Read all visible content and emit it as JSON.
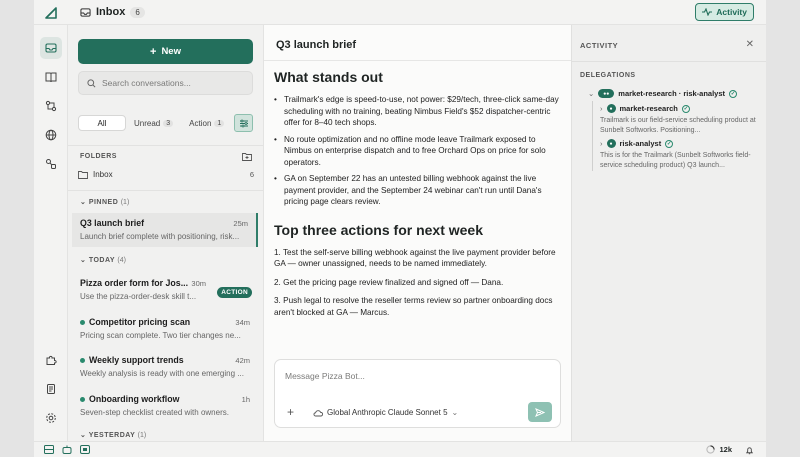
{
  "header": {
    "title": "Inbox",
    "count": "6",
    "activity_label": "Activity"
  },
  "rail": {
    "items": [
      "inbox-icon",
      "book-icon",
      "workflow-icon",
      "globe-icon",
      "connections-icon",
      "puzzle-icon",
      "scroll-icon",
      "gear-icon"
    ]
  },
  "sidebar": {
    "new_label": "New",
    "search_placeholder": "Search conversations...",
    "filters": [
      {
        "label": "All"
      },
      {
        "label": "Unread",
        "count": "3"
      },
      {
        "label": "Action",
        "count": "1"
      }
    ],
    "folders_label": "FOLDERS",
    "folder": {
      "name": "Inbox",
      "count": "6"
    },
    "pinned_label": "PINNED",
    "pinned_count": "(1)",
    "today_label": "TODAY",
    "today_count": "(4)",
    "yesterday_label": "YESTERDAY",
    "yesterday_count": "(1)",
    "conversations": [
      {
        "title": "Q3 launch brief",
        "time": "25m",
        "snippet": "Launch brief complete with positioning, risk..."
      },
      {
        "title": "Pizza order form for Jos...",
        "time": "30m",
        "snippet": "Use the pizza-order-desk skill t...",
        "badge": "ACTION"
      },
      {
        "title": "Competitor pricing scan",
        "time": "34m",
        "snippet": "Pricing scan complete. Two tier changes ne..."
      },
      {
        "title": "Weekly support trends",
        "time": "42m",
        "snippet": "Weekly analysis is ready with one emerging ..."
      },
      {
        "title": "Onboarding workflow",
        "time": "1h",
        "snippet": "Seven-step checklist created with owners."
      }
    ]
  },
  "main": {
    "title": "Q3 launch brief",
    "h1": "What stands out",
    "bullets": [
      "Trailmark's edge is speed-to-use, not power: $29/tech, three-click same-day scheduling with no training, beating Nimbus Field's $52 dispatcher-centric offer for 8–40 tech shops.",
      "No route optimization and no offline mode leave Trailmark exposed to Nimbus on enterprise dispatch and to free Orchard Ops on price for solo operators.",
      "GA on September 22 has an untested billing webhook against the live payment provider, and the September 24 webinar can't run until Dana's pricing page clears review."
    ],
    "h2": "Top three actions for next week",
    "actions": [
      "1. Test the self-serve billing webhook against the live payment provider before GA — owner unassigned, needs to be named immediately.",
      "2. Get the pricing page review finalized and signed off — Dana.",
      "3. Push legal to resolve the reseller terms review so partner onboarding docs aren't blocked at GA — Marcus."
    ],
    "composer_placeholder": "Message Pizza Bot...",
    "model_label": "Global Anthropic Claude Sonnet 5"
  },
  "activity": {
    "title": "ACTIVITY",
    "section": "DELEGATIONS",
    "root": "market-research · risk-analyst",
    "children": [
      {
        "name": "market-research",
        "desc": "Trailmark is our field-service scheduling product at Sunbelt Softworks. Positioning..."
      },
      {
        "name": "risk-analyst",
        "desc": "This is for the Trailmark (Sunbelt Softworks field-service scheduling product) Q3 launch..."
      }
    ]
  },
  "statusbar": {
    "tokens": "12k"
  },
  "colors": {
    "accent": "#236f5c",
    "accent_light": "#d6ebe3"
  }
}
